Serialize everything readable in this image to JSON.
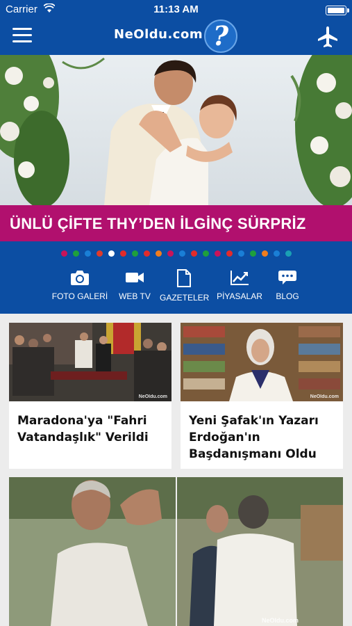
{
  "status": {
    "carrier": "Carrier",
    "time": "11:13 AM"
  },
  "header": {
    "logo_text": "NeOldu.com",
    "logo_mark": "?"
  },
  "hero": {
    "headline": "ÜNLÜ ÇİFTE THY’DEN İLGİNÇ SÜRPRİZ"
  },
  "slider": {
    "active_index": 4,
    "dot_colors": [
      "#c8145a",
      "#1ea03c",
      "#1a7fd6",
      "#e03a2a",
      "#ffffff",
      "#e22b2b",
      "#1ea03c",
      "#e22b2b",
      "#f07d1e",
      "#c8145a",
      "#1a7fd6",
      "#e22b2b",
      "#1ea03c",
      "#c8145a",
      "#e22b2b",
      "#1a7fd6",
      "#1ea03c",
      "#f07d1e",
      "#1a7fd6",
      "#1aa0b4"
    ]
  },
  "categories": [
    {
      "label": "FOTO GALERİ",
      "icon": "camera-icon"
    },
    {
      "label": "WEB TV",
      "icon": "video-camera-icon"
    },
    {
      "label": "GAZETELER",
      "icon": "document-icon"
    },
    {
      "label": "PİYASALAR",
      "icon": "chart-icon"
    },
    {
      "label": "BLOG",
      "icon": "chat-bubble-icon"
    }
  ],
  "news": [
    {
      "title": "Maradona'ya \"Fahri Vatandaşlık\" Verildi",
      "watermark": "NeOldu.com"
    },
    {
      "title": "Yeni Şafak'ın Yazarı Erdoğan'ın Başdanışmanı Oldu",
      "watermark": "NeOldu.com"
    }
  ],
  "featured": {
    "watermark": "NeOldu.com"
  },
  "colors": {
    "brand_blue": "#0c4ea3",
    "headline_magenta": "#b1106e"
  }
}
